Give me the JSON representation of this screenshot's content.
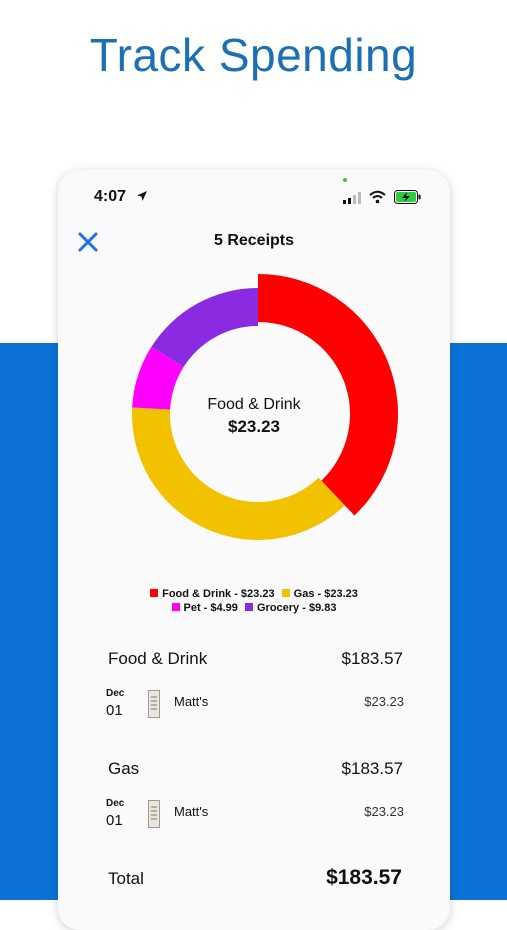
{
  "headline": "Track Spending",
  "status_bar": {
    "time": "4:07"
  },
  "nav": {
    "title": "5 Receipts"
  },
  "donut_center": {
    "label": "Food & Drink",
    "value": "$23.23"
  },
  "legend": [
    {
      "label": "Food & Drink - $23.23",
      "color": "#ff0000"
    },
    {
      "label": "Gas - $23.23",
      "color": "#f2c200"
    },
    {
      "label": "Pet - $4.99",
      "color": "#ff00ff"
    },
    {
      "label": "Grocery - $9.83",
      "color": "#8a2be2"
    }
  ],
  "chart_data": {
    "type": "pie",
    "categories": [
      "Food & Drink",
      "Gas",
      "Pet",
      "Grocery"
    ],
    "values": [
      23.23,
      23.23,
      4.99,
      9.83
    ],
    "colors": [
      "#ff0000",
      "#f2c200",
      "#ff00ff",
      "#8a2be2"
    ],
    "highlighted": "Food & Drink",
    "donut": true
  },
  "categories": [
    {
      "name": "Food & Drink",
      "total": "$183.57",
      "receipts": [
        {
          "month": "Dec",
          "day": "01",
          "merchant": "Matt's",
          "amount": "$23.23"
        }
      ]
    },
    {
      "name": "Gas",
      "total": "$183.57",
      "receipts": [
        {
          "month": "Dec",
          "day": "01",
          "merchant": "Matt's",
          "amount": "$23.23"
        }
      ]
    }
  ],
  "total": {
    "label": "Total",
    "value": "$183.57"
  }
}
